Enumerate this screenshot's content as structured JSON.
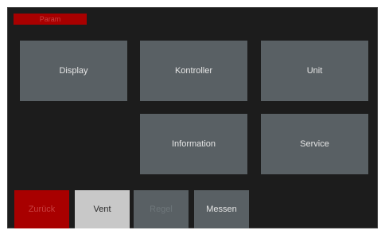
{
  "header": {
    "title": "Param"
  },
  "menu": {
    "display": "Display",
    "kontroller": "Kontroller",
    "unit": "Unit",
    "information": "Information",
    "service": "Service"
  },
  "nav": {
    "zurueck": "Zurück",
    "vent": "Vent",
    "regel": "Regel",
    "messen": "Messen"
  },
  "colors": {
    "accent_red": "#a80000",
    "tile_gray": "#596064",
    "selected_tab": "#c8c8c8",
    "background": "#1c1c1c"
  }
}
